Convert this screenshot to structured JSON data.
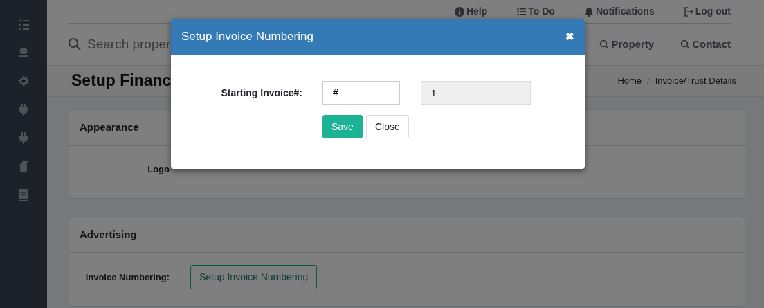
{
  "top_links": [
    {
      "label": "Help"
    },
    {
      "label": "To Do"
    },
    {
      "label": "Notifications"
    },
    {
      "label": "Log out"
    }
  ],
  "search": {
    "placeholder": "Search proper"
  },
  "search_links": [
    {
      "label": "Property"
    },
    {
      "label": "Contact"
    }
  ],
  "page_title": "Setup Financ",
  "breadcrumb_separator": "/",
  "breadcrumb": [
    {
      "label": "Home"
    },
    {
      "label": "Invoice/Trust Details"
    }
  ],
  "cards": [
    {
      "title": "Appearance",
      "rows": [
        {
          "label": "Logo"
        }
      ]
    },
    {
      "title": "Advertising",
      "rows": [
        {
          "label": "Invoice Numbering:",
          "button": "Setup Invoice Numbering"
        }
      ]
    }
  ],
  "modal": {
    "title": "Setup Invoice Numbering",
    "close": "✖",
    "label": "Starting Invoice#:",
    "prefix_value": "#",
    "number_value": "1",
    "number_disabled": true,
    "buttons": [
      {
        "label": "Save",
        "kind": "primary"
      },
      {
        "label": "Close",
        "kind": "default"
      }
    ]
  }
}
